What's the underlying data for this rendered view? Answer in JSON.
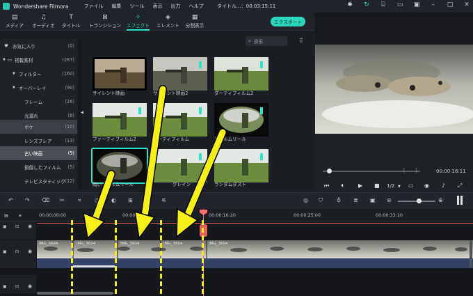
{
  "app": {
    "name": "Wondershare Filmora",
    "title": "タイトル...：00:03:15:11"
  },
  "menu": [
    "ファイル",
    "編集",
    "ツール",
    "表示",
    "出力",
    "ヘルプ"
  ],
  "titlebar_icons": [
    "lightbulb-icon",
    "sync-icon",
    "gift-icon",
    "folder-icon",
    "save-icon",
    "minimize-icon",
    "maximize-icon",
    "close-icon"
  ],
  "tabs": [
    {
      "label": "メディア",
      "icon": "media-icon",
      "active": false
    },
    {
      "label": "オーディオ",
      "icon": "music-note-icon",
      "active": false
    },
    {
      "label": "タイトル",
      "icon": "title-t-icon",
      "active": false
    },
    {
      "label": "トランジション",
      "icon": "transition-icon",
      "active": false
    },
    {
      "label": "エフェクト",
      "icon": "effects-sparkle-icon",
      "active": true
    },
    {
      "label": "エレメント",
      "icon": "element-icon",
      "active": false
    },
    {
      "label": "分割表示",
      "icon": "split-screen-icon",
      "active": false
    }
  ],
  "export_label": "エクスポート",
  "search": {
    "placeholder": "検索"
  },
  "sidebar": [
    {
      "label": "お気に入り",
      "count": "(0)",
      "icon": "heart-icon",
      "indent": 0
    },
    {
      "label": "搭載素材",
      "count": "(287)",
      "icon": "folder-icon",
      "indent": 0
    },
    {
      "label": "フィルター",
      "count": "(160)",
      "indent": 1
    },
    {
      "label": "オーバーレイ",
      "count": "(90)",
      "indent": 1
    },
    {
      "label": "フレーム",
      "count": "(26)",
      "indent": 2
    },
    {
      "label": "光漏れ",
      "count": "(8)",
      "indent": 2
    },
    {
      "label": "ボケ",
      "count": "(10)",
      "indent": 2,
      "selected": true
    },
    {
      "label": "レンズフレア",
      "count": "(13)",
      "indent": 2
    },
    {
      "label": "古い映画",
      "count": "(9)",
      "indent": 2,
      "highlight": true
    },
    {
      "label": "損傷したフィルム",
      "count": "(5)",
      "indent": 2
    },
    {
      "label": "テレビスタティック",
      "count": "(12)",
      "indent": 2
    }
  ],
  "effects": [
    {
      "label": "サイレント映画",
      "style": "sepia"
    },
    {
      "label": "サイレント映画2",
      "style": "sepia2"
    },
    {
      "label": "ダーティフィルム2",
      "style": "dirty"
    },
    {
      "label": "ファーティフィルム2",
      "style": "normal"
    },
    {
      "label": "ダーティフィルム",
      "style": "normal"
    },
    {
      "label": "フィルムリール",
      "style": "vignette"
    },
    {
      "label": "暗いフィルムリール",
      "style": "dark",
      "selected": true
    },
    {
      "label": "グレイン",
      "style": "grain"
    },
    {
      "label": "ランダムダスト",
      "style": "normal"
    }
  ],
  "preview": {
    "time": "00:00:16:11",
    "zoom": "1/2"
  },
  "timeline": {
    "ruler": [
      "00:00:00:00",
      "00:00:08:08",
      "00:00:16:20",
      "00:00:25:00",
      "00:00:33:10"
    ],
    "clips": [
      "IMG_3604",
      "IMG_3604",
      "IMG_3604",
      "IMG_3604",
      "IMG_3604"
    ]
  }
}
